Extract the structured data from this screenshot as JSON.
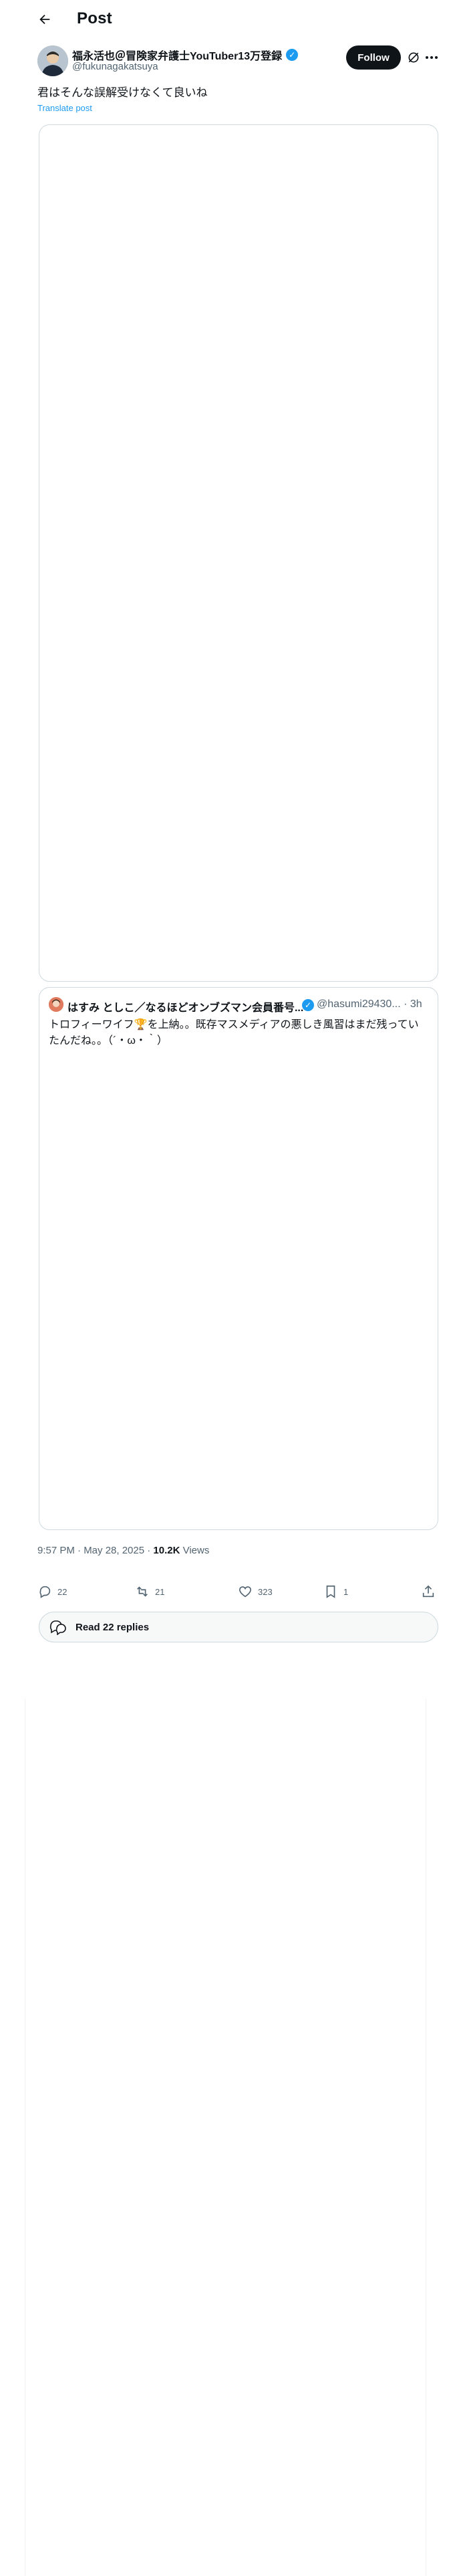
{
  "header": {
    "title": "Post"
  },
  "author": {
    "name": "福永活也＠冒険家弁護士YouTuber13万登録",
    "handle": "@fukunagakatsuya",
    "follow_label": "Follow"
  },
  "post": {
    "text": "君はそんな誤解受けなくて良いね",
    "translate_label": "Translate post"
  },
  "quote": {
    "name": "はすみ としこ／なるほどオンブズマン会員番号...",
    "handle": "@hasumi29430... · 3h",
    "text": "トロフィーワイフ🏆を上納。。既存マスメディアの悪しき風習はまだ残っていたんだね。。（´・ω・｀）"
  },
  "meta": {
    "timestamp": "9:57 PM · May 28, 2025 · ",
    "views_count": "10.2K",
    "views_label": " Views"
  },
  "actions": {
    "replies": "22",
    "reposts": "21",
    "likes": "323",
    "bookmarks": "1"
  },
  "read_replies": {
    "label": "Read 22 replies"
  },
  "icons": {
    "back": "arrow-left-icon",
    "grok": "grok-icon",
    "more": "more-icon",
    "reply": "reply-icon",
    "repost": "repost-icon",
    "like": "heart-icon",
    "bookmark": "bookmark-icon",
    "share": "share-icon"
  },
  "colors": {
    "accent": "#1d9bf0",
    "text": "#0f1419",
    "muted": "#536471",
    "border": "#cfd9de"
  }
}
